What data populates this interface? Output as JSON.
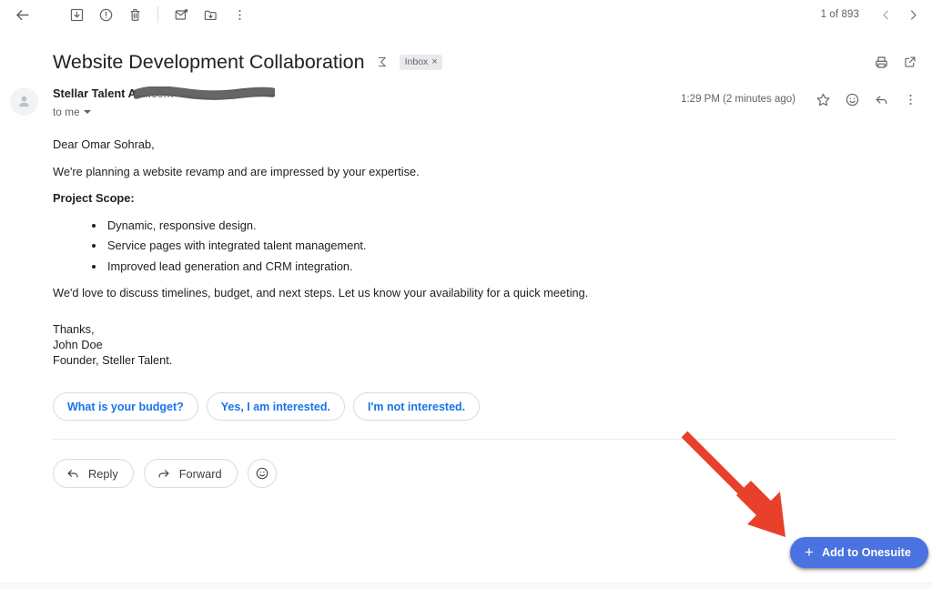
{
  "toolbar": {
    "back_label": "Back",
    "archive_label": "Archive",
    "report_spam_label": "Report spam",
    "delete_label": "Delete",
    "mark_unread_label": "Mark as unread",
    "move_to_label": "Move to",
    "more_label": "More",
    "pagination": "1 of 893",
    "prev_label": "Older",
    "next_label": "Newer"
  },
  "subject": {
    "title": "Website Development Collaboration",
    "summarize_icon": "sigma-icon",
    "label_chip": "Inbox",
    "label_chip_remove": "×",
    "print_label": "Print all",
    "popout_label": "Open in new window"
  },
  "message": {
    "sender_name": "Stellar Talent A",
    "sender_email_visible": "ail.com>",
    "recipient": "to me",
    "timestamp": "1:29 PM (2 minutes ago)",
    "star_label": "Star",
    "react_label": "Add emoji reaction",
    "reply_icon_label": "Reply",
    "more_label": "More"
  },
  "body": {
    "greeting": "Dear Omar Sohrab,",
    "intro": "We're planning a website revamp and are impressed by your expertise.",
    "scope_heading": "Project Scope:",
    "scope_items": [
      "Dynamic, responsive design.",
      "Service pages with integrated talent management.",
      "Improved lead generation and CRM integration."
    ],
    "closing": "We'd love to discuss timelines, budget, and next steps. Let us know your availability for a quick meeting.",
    "signoff": "Thanks,",
    "signer_name": "John Doe",
    "signer_title": "Founder, Steller Talent."
  },
  "smart_replies": [
    "What is your budget?",
    "Yes, I am interested.",
    "I'm not interested."
  ],
  "actions": {
    "reply_label": "Reply",
    "forward_label": "Forward",
    "emoji_label": "React"
  },
  "fab": {
    "plus": "+",
    "label": "Add to Onesuite"
  },
  "colors": {
    "accent_blue": "#1a73e8",
    "fab_blue": "#4a72e0",
    "annotation_red": "#e8402a",
    "text_primary": "#202124",
    "text_secondary": "#5f6368",
    "chip_bg": "#e8eaed",
    "border": "#dadce0"
  }
}
